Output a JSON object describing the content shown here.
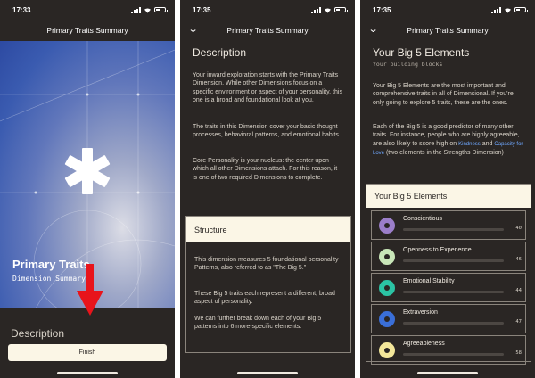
{
  "screens": [
    {
      "time": "17:33",
      "nav_title": "Primary Traits Summary",
      "hero_title": "Primary Traits",
      "hero_subtitle": "Dimension Summary",
      "next_section_peek": "Description",
      "finish_label": "Finish"
    },
    {
      "time": "17:35",
      "nav_title": "Primary Traits Summary",
      "section_title": "Description",
      "paragraphs": [
        "Your inward exploration starts with the Primary Traits Dimension. While other Dimensions focus on a specific environment or aspect of your personality, this one is a broad and foundational look at you.",
        "The traits in this Dimension cover your basic thought processes, behavioral patterns, and emotional habits.",
        "Core Personality is your nucleus: the center upon which all other Dimensions attach. For this reason, it is one of two required Dimensions to complete."
      ],
      "structure": {
        "heading": "Structure",
        "paragraphs": [
          "This dimension measures 5 foundational personality Patterns, also referred to as \"The Big 5.\"",
          "These Big 5 traits each represent a different, broad aspect of personality.",
          "We can further break down each of your Big 5 patterns into 6 more-specific elements."
        ]
      }
    },
    {
      "time": "17:35",
      "nav_title": "Primary Traits Summary",
      "section_title": "Your Big 5 Elements",
      "section_subtitle": "Your building blocks",
      "paragraph1": "Your Big 5 Elements are the most important and comprehensive traits in all of Dimensional. If you're only going to explore 5 traits, these are the ones.",
      "paragraph2": {
        "before": "Each of the Big 5 is a good predictor of many other traits. For instance, people who are highly agreeable, are also likely to score high on",
        "link1": "Kindness",
        "middle": "and",
        "link2": "Capacity for Love",
        "after": "(two elements in the Strengths Dimension)"
      },
      "elements_box_title": "Your Big 5 Elements",
      "elements": [
        {
          "name": "Conscientious",
          "score": "40",
          "value": 40,
          "color": "#9b7ec9"
        },
        {
          "name": "Openness to Experience",
          "score": "46",
          "value": 46,
          "color": "#c8e6b8"
        },
        {
          "name": "Emotional Stability",
          "score": "44",
          "value": 44,
          "color": "#2bc3a4"
        },
        {
          "name": "Extraversion",
          "score": "47",
          "value": 47,
          "color": "#3a6fd8"
        },
        {
          "name": "Agreeableness",
          "score": "58",
          "value": 58,
          "color": "#f3e79a"
        }
      ]
    }
  ]
}
